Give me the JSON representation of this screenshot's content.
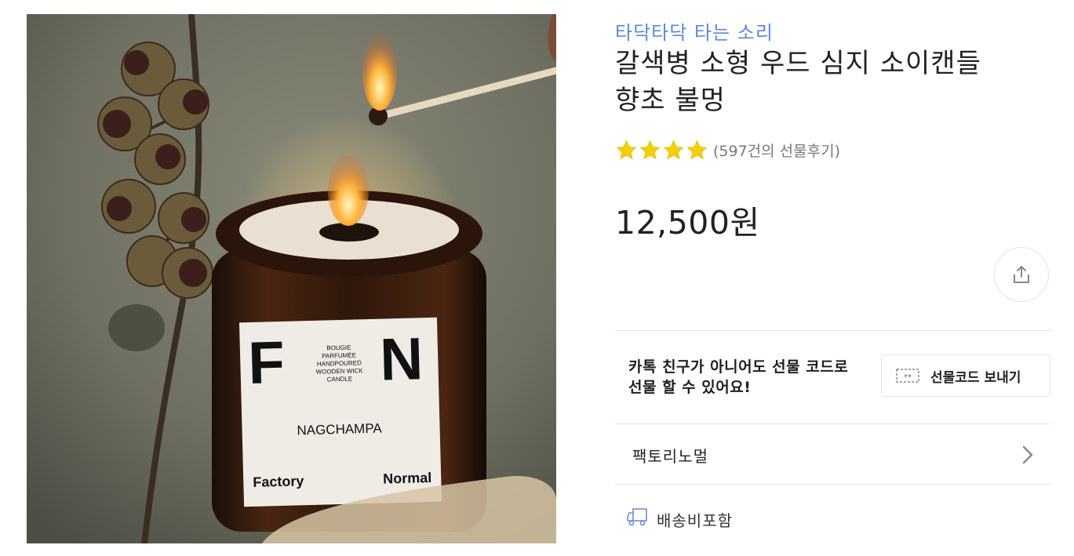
{
  "product": {
    "brand_name": "타닥타닥 타는 소리",
    "title_line1": "갈색병 소형 우드 심지 소이캔들",
    "title_line2": "향초 불멍",
    "rating_stars": 4,
    "review_count_text": "(597건의 선물후기)",
    "price": "12,500원",
    "image": {
      "label_big_left": "F",
      "label_big_right": "N",
      "label_desc": [
        "BOUGIE",
        "PARFUMÉE",
        "HANDPOURED",
        "WOODEN WICK",
        "CANDLE"
      ],
      "label_scent": "NAGCHAMPA",
      "label_bottom_left": "Factory",
      "label_bottom_right": "Normal"
    }
  },
  "gift": {
    "text_line1": "카톡 친구가 아니어도 선물 코드로",
    "text_line2": "선물 할 수 있어요!",
    "button_label": "선물코드 보내기"
  },
  "seller": {
    "name": "팩토리노멀"
  },
  "shipping": {
    "label": "배송비포함"
  },
  "icons": {
    "share": "share-icon",
    "gift_code": "ticket-icon",
    "chevron": "chevron-right-icon",
    "shipping": "delivery-truck-icon",
    "star": "star-icon"
  },
  "colors": {
    "brand_link": "#5b8ad6",
    "star": "#f5d000",
    "divider": "#e6e6e6"
  }
}
